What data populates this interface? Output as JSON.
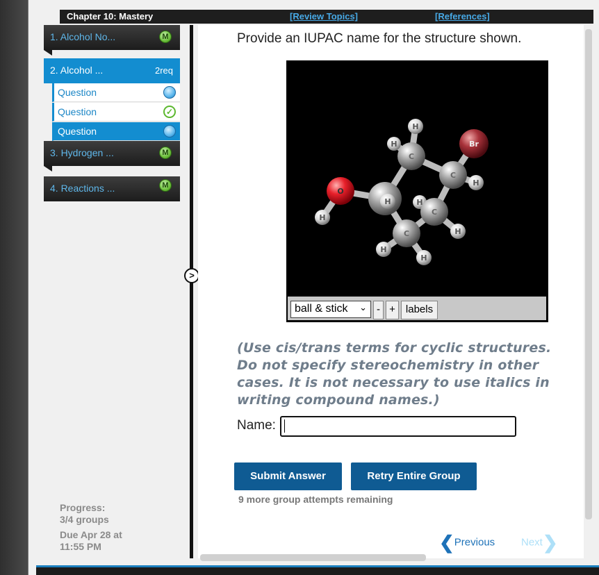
{
  "header": {
    "chapter": "Chapter 10: Mastery",
    "review_topics": "[Review Topics]",
    "references": "[References]"
  },
  "sidebar": {
    "sections": [
      {
        "label": "1. Alcohol No...",
        "badge": "M"
      },
      {
        "label": "2. Alcohol ...",
        "req": "2req"
      },
      {
        "label": "3. Hydrogen ...",
        "badge": "M"
      },
      {
        "label": "4. Reactions ...",
        "badge": "M"
      }
    ],
    "questions": [
      {
        "label": "Question",
        "status": "in-progress"
      },
      {
        "label": "Question",
        "status": "correct"
      },
      {
        "label": "Question",
        "status": "current"
      }
    ],
    "progress_label": "Progress:",
    "progress_value": "3/4 groups",
    "due": "Due Apr 28 at 11:55 PM"
  },
  "toggle_label": ">",
  "question": {
    "prompt": "Provide an IUPAC name for the structure shown.",
    "instructions": "(Use cis/trans terms for cyclic structures. Do not specify stereochemistry in other cases. It is not necessary to use italics in writing compound names.)",
    "name_label": "Name:",
    "name_value": ""
  },
  "molecule": {
    "atoms": {
      "H": "H",
      "C": "C",
      "O": "O",
      "Br": "Br"
    },
    "viewer": {
      "style_select": "ball & stick",
      "zoom_out": "-",
      "zoom_in": "+",
      "labels_button": "labels"
    }
  },
  "actions": {
    "submit": "Submit Answer",
    "retry": "Retry Entire Group",
    "attempts": "9 more group attempts remaining",
    "previous": "Previous",
    "next": "Next"
  },
  "colors": {
    "accent": "#138dd0",
    "button": "#0f5b93",
    "oxygen": "#e8202a",
    "bromine": "#a8323a",
    "carbon": "#9a9a9a"
  }
}
